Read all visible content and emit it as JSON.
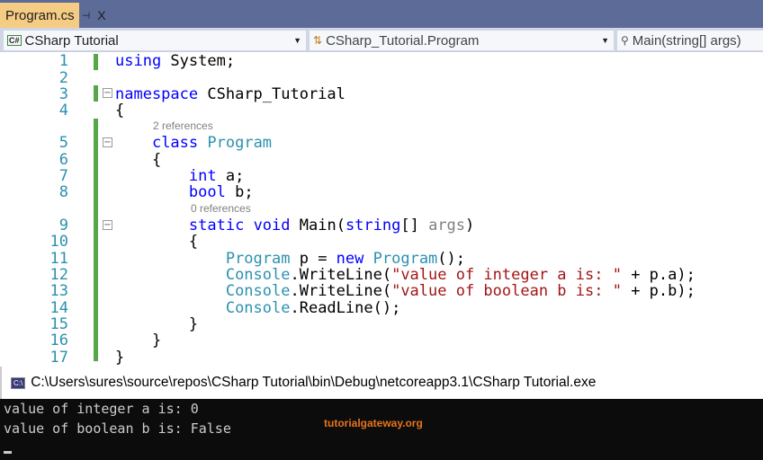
{
  "tab": {
    "title": "Program.cs",
    "pin": "⊣",
    "close": "X"
  },
  "nav": {
    "project": "CSharp Tutorial",
    "project_icon": "C#",
    "class": "CSharp_Tutorial.Program",
    "member": "Main(string[] args)"
  },
  "editor": {
    "lines": [
      {
        "n": "1",
        "segs": [
          [
            "using",
            "kw"
          ],
          [
            " System;",
            "id"
          ]
        ]
      },
      {
        "n": "2",
        "segs": []
      },
      {
        "n": "3",
        "segs": [
          [
            "namespace",
            "kw"
          ],
          [
            " CSharp_Tutorial",
            "id"
          ]
        ]
      },
      {
        "n": "4",
        "segs": [
          [
            "{",
            "id"
          ]
        ]
      },
      {
        "n": "5",
        "segs": [
          [
            "    ",
            "id"
          ],
          [
            "class",
            "kw"
          ],
          [
            " ",
            "id"
          ],
          [
            "Program",
            "ty"
          ]
        ]
      },
      {
        "n": "6",
        "segs": [
          [
            "    {",
            "id"
          ]
        ]
      },
      {
        "n": "7",
        "segs": [
          [
            "        ",
            "id"
          ],
          [
            "int",
            "kw"
          ],
          [
            " a;",
            "id"
          ]
        ]
      },
      {
        "n": "8",
        "segs": [
          [
            "        ",
            "id"
          ],
          [
            "bool",
            "kw"
          ],
          [
            " b;",
            "id"
          ]
        ]
      },
      {
        "n": "9",
        "segs": [
          [
            "        ",
            "id"
          ],
          [
            "static",
            "kw"
          ],
          [
            " ",
            "id"
          ],
          [
            "void",
            "kw"
          ],
          [
            " Main(",
            "id"
          ],
          [
            "string",
            "kw"
          ],
          [
            "[] ",
            "id"
          ],
          [
            "args",
            "pa"
          ],
          [
            ")",
            "id"
          ]
        ]
      },
      {
        "n": "10",
        "segs": [
          [
            "        {",
            "id"
          ]
        ]
      },
      {
        "n": "11",
        "segs": [
          [
            "            ",
            "id"
          ],
          [
            "Program",
            "ty"
          ],
          [
            " p = ",
            "id"
          ],
          [
            "new",
            "kw"
          ],
          [
            " ",
            "id"
          ],
          [
            "Program",
            "ty"
          ],
          [
            "();",
            "id"
          ]
        ]
      },
      {
        "n": "12",
        "segs": [
          [
            "            ",
            "id"
          ],
          [
            "Console",
            "ty"
          ],
          [
            ".WriteLine(",
            "id"
          ],
          [
            "\"value of integer a is: \"",
            "st"
          ],
          [
            " + p.a);",
            "id"
          ]
        ]
      },
      {
        "n": "13",
        "segs": [
          [
            "            ",
            "id"
          ],
          [
            "Console",
            "ty"
          ],
          [
            ".WriteLine(",
            "id"
          ],
          [
            "\"value of boolean b is: \"",
            "st"
          ],
          [
            " + p.b);",
            "id"
          ]
        ]
      },
      {
        "n": "14",
        "segs": [
          [
            "            ",
            "id"
          ],
          [
            "Console",
            "ty"
          ],
          [
            ".ReadLine();",
            "id"
          ]
        ]
      },
      {
        "n": "15",
        "segs": [
          [
            "        }",
            "id"
          ]
        ]
      },
      {
        "n": "16",
        "segs": [
          [
            "    }",
            "id"
          ]
        ]
      },
      {
        "n": "17",
        "segs": [
          [
            "}",
            "id"
          ]
        ]
      }
    ],
    "lens": [
      "2 references",
      "0 references"
    ]
  },
  "console": {
    "title": "C:\\Users\\sures\\source\\repos\\CSharp Tutorial\\bin\\Debug\\netcoreapp3.1\\CSharp Tutorial.exe",
    "icon": "C:\\",
    "output": [
      "value of integer a is: 0",
      "value of boolean b is: False"
    ],
    "watermark": "tutorialgateway.org"
  }
}
